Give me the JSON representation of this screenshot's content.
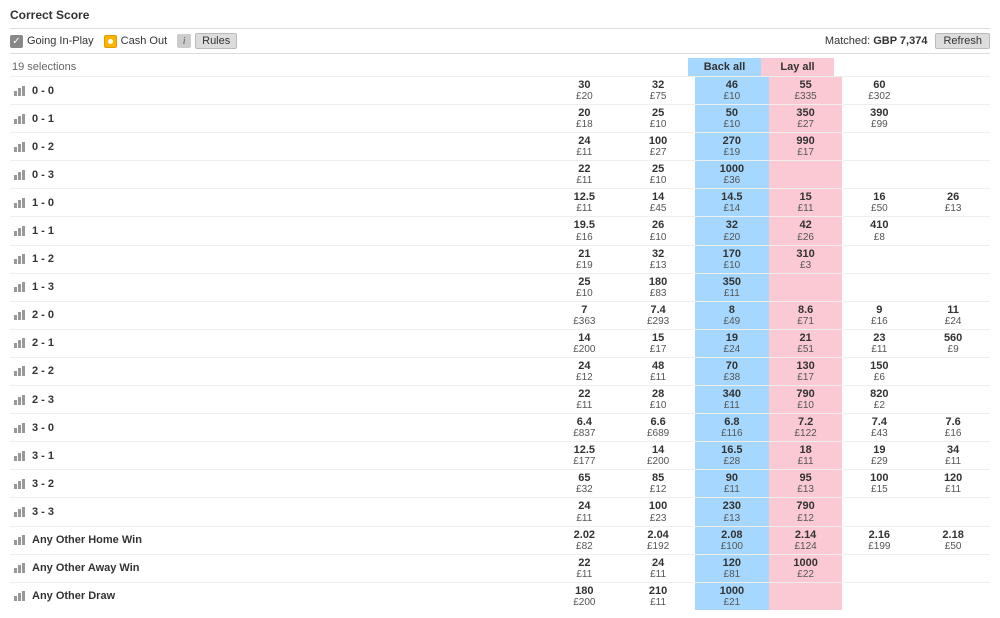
{
  "title": "Correct Score",
  "toolbar": {
    "going_in_play": "Going In-Play",
    "cash_out": "Cash Out",
    "rules": "Rules",
    "matched_label": "Matched:",
    "matched_value": "GBP 7,374",
    "refresh": "Refresh"
  },
  "header": {
    "selections_count": "19 selections",
    "back_all": "Back all",
    "lay_all": "Lay all"
  },
  "rows": [
    {
      "name": "0 - 0",
      "cells": [
        {
          "p": "30",
          "s": "£20"
        },
        {
          "p": "32",
          "s": "£75"
        },
        {
          "p": "46",
          "s": "£10"
        },
        {
          "p": "55",
          "s": "£335"
        },
        {
          "p": "60",
          "s": "£302"
        },
        null
      ]
    },
    {
      "name": "0 - 1",
      "cells": [
        {
          "p": "20",
          "s": "£18"
        },
        {
          "p": "25",
          "s": "£10"
        },
        {
          "p": "50",
          "s": "£10"
        },
        {
          "p": "350",
          "s": "£27"
        },
        {
          "p": "390",
          "s": "£99"
        },
        null
      ]
    },
    {
      "name": "0 - 2",
      "cells": [
        {
          "p": "24",
          "s": "£11"
        },
        {
          "p": "100",
          "s": "£27"
        },
        {
          "p": "270",
          "s": "£19"
        },
        {
          "p": "990",
          "s": "£17"
        },
        null,
        null
      ]
    },
    {
      "name": "0 - 3",
      "cells": [
        {
          "p": "22",
          "s": "£11"
        },
        {
          "p": "25",
          "s": "£10"
        },
        {
          "p": "1000",
          "s": "£36"
        },
        null,
        null,
        null
      ]
    },
    {
      "name": "1 - 0",
      "cells": [
        {
          "p": "12.5",
          "s": "£11"
        },
        {
          "p": "14",
          "s": "£45"
        },
        {
          "p": "14.5",
          "s": "£14"
        },
        {
          "p": "15",
          "s": "£11"
        },
        {
          "p": "16",
          "s": "£50"
        },
        {
          "p": "26",
          "s": "£13"
        }
      ]
    },
    {
      "name": "1 - 1",
      "cells": [
        {
          "p": "19.5",
          "s": "£16"
        },
        {
          "p": "26",
          "s": "£10"
        },
        {
          "p": "32",
          "s": "£20"
        },
        {
          "p": "42",
          "s": "£26"
        },
        {
          "p": "410",
          "s": "£8"
        },
        null
      ]
    },
    {
      "name": "1 - 2",
      "cells": [
        {
          "p": "21",
          "s": "£19"
        },
        {
          "p": "32",
          "s": "£13"
        },
        {
          "p": "170",
          "s": "£10"
        },
        {
          "p": "310",
          "s": "£3"
        },
        null,
        null
      ]
    },
    {
      "name": "1 - 3",
      "cells": [
        {
          "p": "25",
          "s": "£10"
        },
        {
          "p": "180",
          "s": "£83"
        },
        {
          "p": "350",
          "s": "£11"
        },
        null,
        null,
        null
      ]
    },
    {
      "name": "2 - 0",
      "cells": [
        {
          "p": "7",
          "s": "£363"
        },
        {
          "p": "7.4",
          "s": "£293"
        },
        {
          "p": "8",
          "s": "£49"
        },
        {
          "p": "8.6",
          "s": "£71"
        },
        {
          "p": "9",
          "s": "£16"
        },
        {
          "p": "11",
          "s": "£24"
        }
      ]
    },
    {
      "name": "2 - 1",
      "cells": [
        {
          "p": "14",
          "s": "£200"
        },
        {
          "p": "15",
          "s": "£17"
        },
        {
          "p": "19",
          "s": "£24"
        },
        {
          "p": "21",
          "s": "£51"
        },
        {
          "p": "23",
          "s": "£11"
        },
        {
          "p": "560",
          "s": "£9"
        }
      ]
    },
    {
      "name": "2 - 2",
      "cells": [
        {
          "p": "24",
          "s": "£12"
        },
        {
          "p": "48",
          "s": "£11"
        },
        {
          "p": "70",
          "s": "£38"
        },
        {
          "p": "130",
          "s": "£17"
        },
        {
          "p": "150",
          "s": "£6"
        },
        null
      ]
    },
    {
      "name": "2 - 3",
      "cells": [
        {
          "p": "22",
          "s": "£11"
        },
        {
          "p": "28",
          "s": "£10"
        },
        {
          "p": "340",
          "s": "£11"
        },
        {
          "p": "790",
          "s": "£10"
        },
        {
          "p": "820",
          "s": "£2"
        },
        null
      ]
    },
    {
      "name": "3 - 0",
      "cells": [
        {
          "p": "6.4",
          "s": "£837"
        },
        {
          "p": "6.6",
          "s": "£689"
        },
        {
          "p": "6.8",
          "s": "£116"
        },
        {
          "p": "7.2",
          "s": "£122"
        },
        {
          "p": "7.4",
          "s": "£43"
        },
        {
          "p": "7.6",
          "s": "£16"
        }
      ]
    },
    {
      "name": "3 - 1",
      "cells": [
        {
          "p": "12.5",
          "s": "£177"
        },
        {
          "p": "14",
          "s": "£200"
        },
        {
          "p": "16.5",
          "s": "£28"
        },
        {
          "p": "18",
          "s": "£11"
        },
        {
          "p": "19",
          "s": "£29"
        },
        {
          "p": "34",
          "s": "£11"
        }
      ]
    },
    {
      "name": "3 - 2",
      "cells": [
        {
          "p": "65",
          "s": "£32"
        },
        {
          "p": "85",
          "s": "£12"
        },
        {
          "p": "90",
          "s": "£11"
        },
        {
          "p": "95",
          "s": "£13"
        },
        {
          "p": "100",
          "s": "£15"
        },
        {
          "p": "120",
          "s": "£11"
        }
      ]
    },
    {
      "name": "3 - 3",
      "cells": [
        {
          "p": "24",
          "s": "£11"
        },
        {
          "p": "100",
          "s": "£23"
        },
        {
          "p": "230",
          "s": "£13"
        },
        {
          "p": "790",
          "s": "£12"
        },
        null,
        null
      ]
    },
    {
      "name": "Any Other Home Win",
      "cells": [
        {
          "p": "2.02",
          "s": "£82"
        },
        {
          "p": "2.04",
          "s": "£192"
        },
        {
          "p": "2.08",
          "s": "£100"
        },
        {
          "p": "2.14",
          "s": "£124"
        },
        {
          "p": "2.16",
          "s": "£199"
        },
        {
          "p": "2.18",
          "s": "£50"
        }
      ]
    },
    {
      "name": "Any Other Away Win",
      "cells": [
        {
          "p": "22",
          "s": "£11"
        },
        {
          "p": "24",
          "s": "£11"
        },
        {
          "p": "120",
          "s": "£81"
        },
        {
          "p": "1000",
          "s": "£22"
        },
        null,
        null
      ]
    },
    {
      "name": "Any Other Draw",
      "cells": [
        {
          "p": "180",
          "s": "£200"
        },
        {
          "p": "210",
          "s": "£11"
        },
        {
          "p": "1000",
          "s": "£21"
        },
        null,
        null,
        null
      ]
    }
  ]
}
